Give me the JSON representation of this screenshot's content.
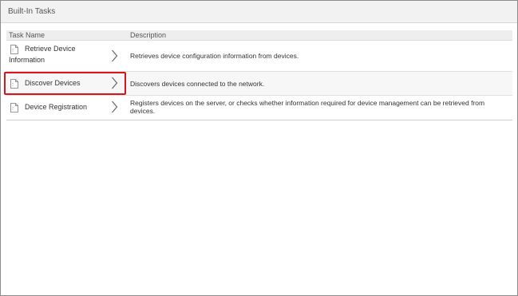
{
  "panel": {
    "title": "Built-In Tasks"
  },
  "table": {
    "columns": [
      "Task Name",
      "Description"
    ],
    "rows": [
      {
        "name": "Retrieve Device Information",
        "description": "Retrieves device configuration information from devices."
      },
      {
        "name": "Discover Devices",
        "description": "Discovers devices connected to the network."
      },
      {
        "name": "Device Registration",
        "description": "Registers devices on the server, or checks whether information required for device management can be retrieved from devices."
      }
    ]
  },
  "icons": {
    "task": "document-icon",
    "expand": "chevron-right-icon"
  },
  "colors": {
    "highlight": "#d8141c",
    "header_bg": "#f2f2f2",
    "column_header_bg": "#eeeeee"
  }
}
